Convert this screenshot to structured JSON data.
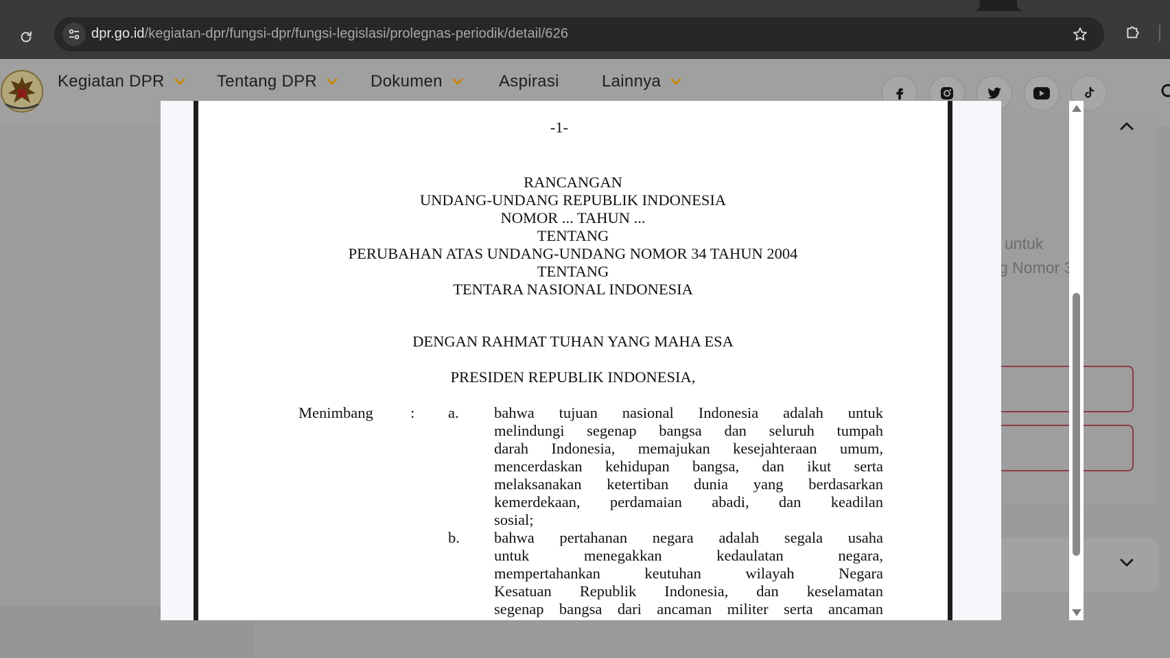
{
  "browser": {
    "url_domain": "dpr.go.id",
    "url_path": "/kegiatan-dpr/fungsi-dpr/fungsi-legislasi/prolegnas-periodik/detail/626"
  },
  "site": {
    "nav": [
      {
        "label": "Kegiatan DPR",
        "has_dropdown": true
      },
      {
        "label": "Tentang DPR",
        "has_dropdown": true
      },
      {
        "label": "Dokumen",
        "has_dropdown": true
      },
      {
        "label": "Aspirasi",
        "has_dropdown": false
      },
      {
        "label": "Lainnya",
        "has_dropdown": true
      }
    ],
    "social_icons": [
      "facebook-icon",
      "instagram-icon",
      "twitter-icon",
      "youtube-icon",
      "tiktok-icon"
    ],
    "background_text": [
      "untuk",
      "g Nomor 3"
    ]
  },
  "pdf": {
    "page_number": "-1-",
    "heading_lines": [
      "RANCANGAN",
      "UNDANG-UNDANG REPUBLIK INDONESIA",
      "NOMOR ... TAHUN ...",
      "TENTANG",
      "PERUBAHAN ATAS UNDANG-UNDANG NOMOR 34 TAHUN 2004",
      "TENTANG",
      "TENTARA NASIONAL INDONESIA"
    ],
    "blessing": "DENGAN RAHMAT TUHAN YANG MAHA ESA",
    "president": "PRESIDEN REPUBLIK INDONESIA,",
    "consider_label": "Menimbang",
    "colon": ":",
    "items": [
      {
        "marker": "a.",
        "lines": [
          "bahwa tujuan nasional Indonesia adalah untuk",
          "melindungi segenap bangsa dan seluruh tumpah",
          "darah Indonesia, memajukan kesejahteraan umum,",
          "mencerdaskan kehidupan bangsa, dan ikut serta",
          "melaksanakan ketertiban dunia yang berdasarkan",
          "kemerdekaan, perdamaian abadi, dan keadilan",
          "sosial;"
        ]
      },
      {
        "marker": "b.",
        "lines": [
          "bahwa pertahanan negara adalah segala usaha",
          "untuk menegakkan kedaulatan negara,",
          "mempertahankan keutuhan wilayah Negara",
          "Kesatuan Republik Indonesia, dan keselamatan",
          "segenap bangsa dari ancaman militer serta ancaman"
        ]
      }
    ]
  },
  "colors": {
    "chrome_bg": "#3a3a3a",
    "omnibox_bg": "#272727",
    "nav_caret": "#c8860a",
    "outline_accent": "#8e3a47"
  }
}
